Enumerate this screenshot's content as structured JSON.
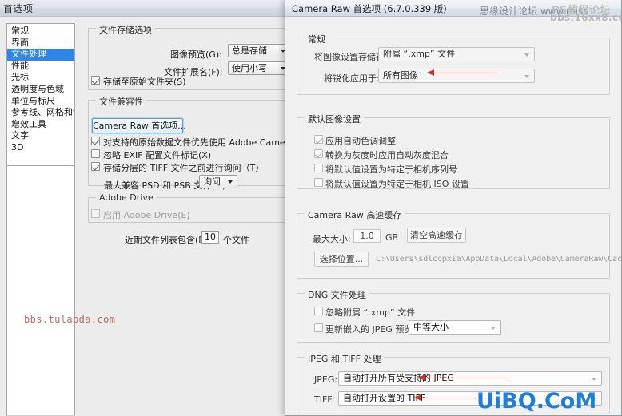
{
  "prefs_window": {
    "title": "首选项",
    "nav": {
      "items": [
        {
          "label": "常规",
          "selected": false
        },
        {
          "label": "界面",
          "selected": false
        },
        {
          "label": "文件处理",
          "selected": true
        },
        {
          "label": "性能",
          "selected": false
        },
        {
          "label": "光标",
          "selected": false
        },
        {
          "label": "透明度与色域",
          "selected": false
        },
        {
          "label": "单位与标尺",
          "selected": false
        },
        {
          "label": "参考线、网格和切片",
          "selected": false
        },
        {
          "label": "增效工具",
          "selected": false
        },
        {
          "label": "文字",
          "selected": false
        },
        {
          "label": "3D",
          "selected": false
        }
      ]
    },
    "file_saving": {
      "group_title": "文件存储选项",
      "image_preview_label": "图像预览(G):",
      "image_preview_value": "总是存储",
      "extension_label": "文件扩展名(F):",
      "extension_value": "使用小写",
      "save_in_original_label": "存储至原始文件夹(S)",
      "save_in_original_checked": true
    },
    "file_compat": {
      "group_title": "文件兼容性",
      "camera_raw_button": "Camera Raw 首选项...",
      "prefer_acr_label": "对支持的原始数据文件优先使用 Adobe Camera Raw(C)",
      "prefer_acr_checked": true,
      "ignore_exif_label": "忽略 EXIF 配置文件标记(X)",
      "ignore_exif_checked": false,
      "ask_tiff_label": "存储分层的 TIFF 文件之前进行询问（T）",
      "ask_tiff_checked": true,
      "max_compat_label": "最大兼容 PSD 和 PSB 文件(M):",
      "max_compat_value": "询问"
    },
    "adobe_drive": {
      "group_title": "Adobe Drive",
      "enable_label": "启用 Adobe Drive(E)",
      "enable_checked": false
    },
    "recent_files": {
      "label": "近期文件列表包含(R):",
      "value": "10",
      "suffix": "个文件"
    }
  },
  "camera_raw_dialog": {
    "title": "Camera Raw 首选项  (6.7.0.339 版)",
    "general": {
      "group_title": "常规",
      "save_settings_label": "将图像设置存储在:",
      "save_settings_value": "附属 “.xmp” 文件",
      "apply_sharpening_label": "将锐化应用于:",
      "apply_sharpening_value": "所有图像"
    },
    "default_image_settings": {
      "group_title": "默认图像设置",
      "items": [
        {
          "label": "应用自动色调调整",
          "checked": true
        },
        {
          "label": "转换为灰度时应用自动灰度混合",
          "checked": true
        },
        {
          "label": "将默认值设置为特定于相机序列号",
          "checked": false
        },
        {
          "label": "将默认值设置为特定于相机 ISO 设置",
          "checked": false
        }
      ]
    },
    "cache": {
      "group_title_prefix": "Camera Raw",
      "group_title_suffix": "高速缓存",
      "max_size_label": "最大大小:",
      "max_size_value": "1.0",
      "unit": "GB",
      "purge_button": "清空高速缓存",
      "select_location_button": "选择位置...",
      "cache_path": "C:\\Users\\sdlccpxia\\AppData\\Local\\Adobe\\CameraRaw\\Cache\\"
    },
    "dng": {
      "group_title": "DNG 文件处理",
      "ignore_xmp_label": "忽略附属 “.xmp” 文件",
      "ignore_xmp_checked": false,
      "update_jpeg_label": "更新嵌入的 JPEG 预览:",
      "update_jpeg_checked": false,
      "update_jpeg_value": "中等大小"
    },
    "jpeg_tiff": {
      "group_title": "JPEG 和 TIFF 处理",
      "jpeg_label": "JPEG:",
      "jpeg_value": "自动打开所有受支持的 JPEG",
      "tiff_label": "TIFF:",
      "tiff_value": "自动打开设置的 TIFF"
    }
  },
  "watermarks": {
    "siyuan": "思缘设计论坛 www.miss",
    "ps_line1": "PS教程论坛",
    "ps_line2": "bbs.16xx8.com",
    "tulaoda": "bbs.tulaoda.com",
    "uibq": "UiBQ.CoM"
  },
  "colors": {
    "selection_blue": "#2f86e8",
    "annotation_red": "#c0392b",
    "uibq_blue": "#1e7fd4"
  }
}
